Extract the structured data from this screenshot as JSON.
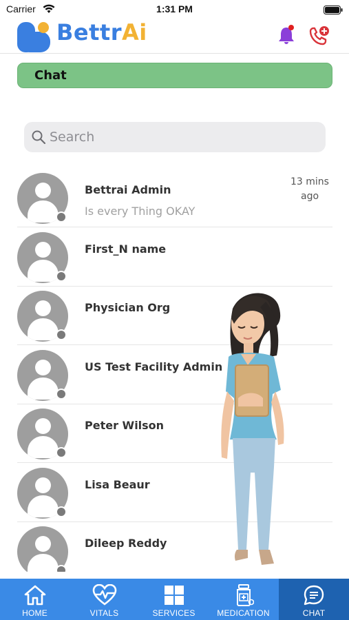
{
  "status_bar": {
    "carrier": "Carrier",
    "time": "1:31 PM"
  },
  "header": {
    "brand_part1": "Bettr",
    "brand_part2": "Ai"
  },
  "chat_bar": {
    "title": "Chat"
  },
  "search": {
    "placeholder": "Search"
  },
  "contacts": [
    {
      "name": "Bettrai Admin",
      "last_message": "Is every Thing OKAY",
      "time": "13 mins ago"
    },
    {
      "name": "First_N name",
      "last_message": "",
      "time": ""
    },
    {
      "name": "Physician Org",
      "last_message": "",
      "time": ""
    },
    {
      "name": "US Test Facility Admin",
      "last_message": "",
      "time": ""
    },
    {
      "name": "Peter Wilson",
      "last_message": "",
      "time": ""
    },
    {
      "name": "Lisa Beaur",
      "last_message": "",
      "time": ""
    },
    {
      "name": "Dileep Reddy",
      "last_message": "",
      "time": ""
    }
  ],
  "tabs": [
    {
      "label": "HOME",
      "icon": "home-icon",
      "active": false
    },
    {
      "label": "VITALS",
      "icon": "heart-pulse-icon",
      "active": false
    },
    {
      "label": "SERVICES",
      "icon": "grid-icon",
      "active": false
    },
    {
      "label": "MEDICATION",
      "icon": "medicine-bottle-icon",
      "active": false
    },
    {
      "label": "CHAT",
      "icon": "chat-bubble-icon",
      "active": true
    }
  ],
  "colors": {
    "brand_blue": "#3a7fe0",
    "brand_orange": "#f2b234",
    "chat_bar_green": "#7cc386",
    "tab_bar_blue": "#3a8ae6",
    "tab_active_blue": "#1e62b0",
    "bell_purple": "#8b3fd9",
    "call_red": "#d9343a"
  }
}
